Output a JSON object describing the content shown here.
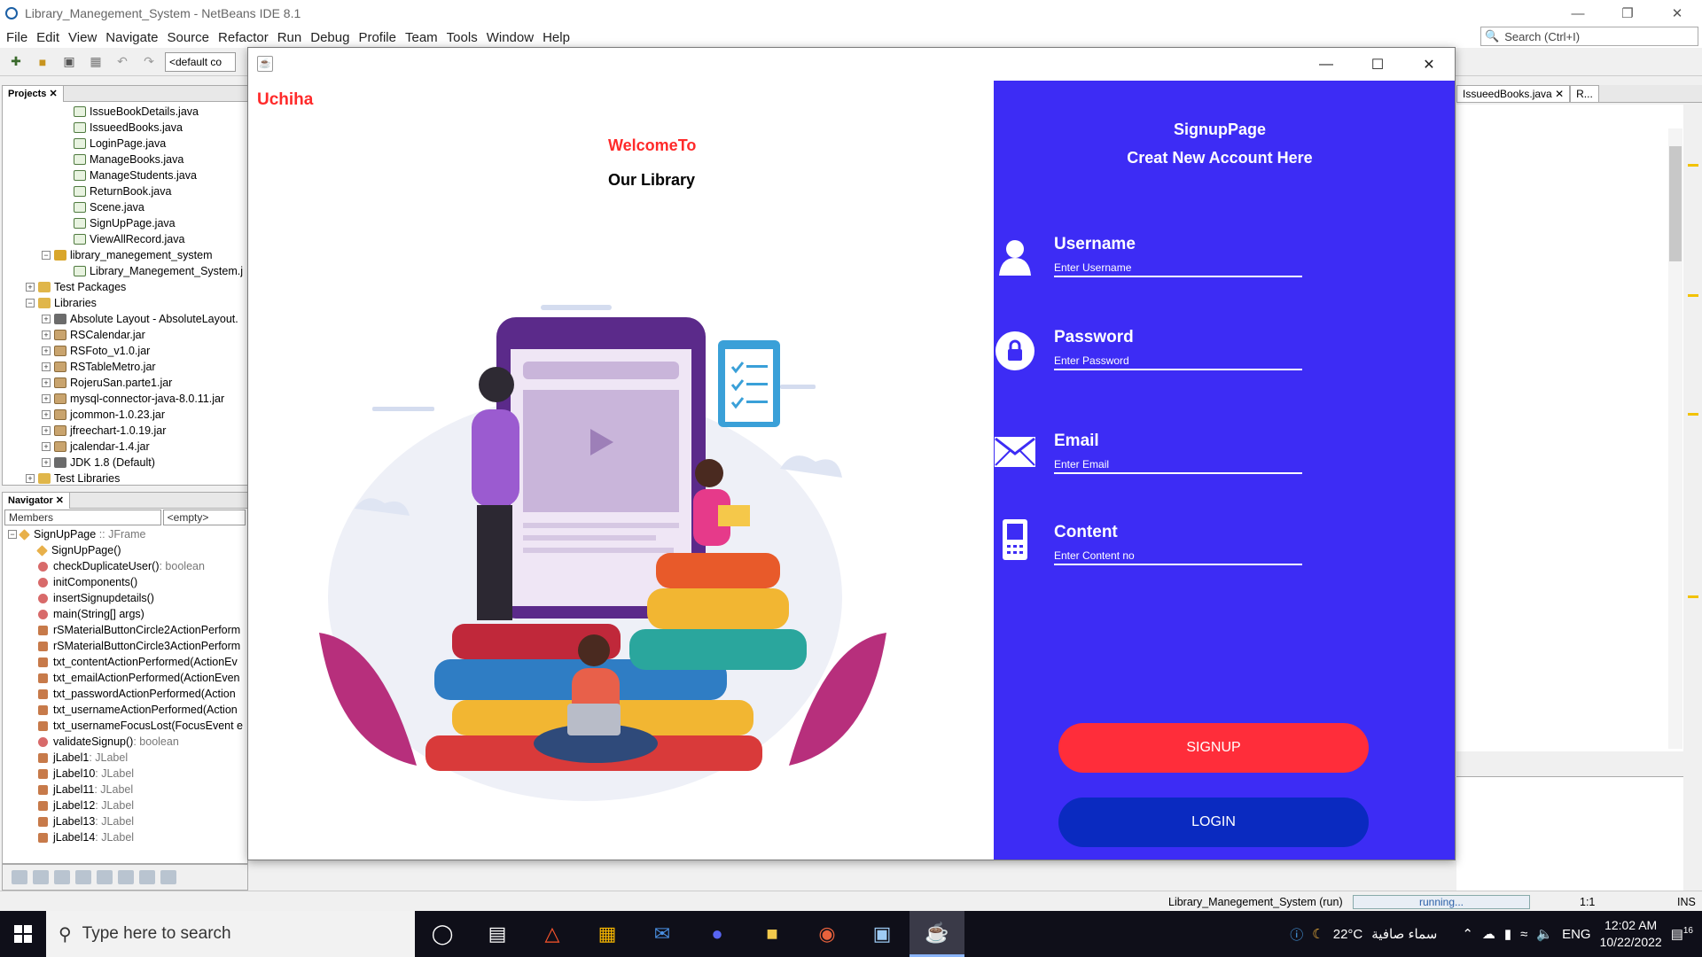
{
  "ide": {
    "title": "Library_Manegement_System - NetBeans IDE 8.1",
    "menu": [
      "File",
      "Edit",
      "View",
      "Navigate",
      "Source",
      "Refactor",
      "Run",
      "Debug",
      "Profile",
      "Team",
      "Tools",
      "Window",
      "Help"
    ],
    "search_placeholder": "Search (Ctrl+I)",
    "config": "<default co",
    "projects_tab": "Projects",
    "navigator_tab": "Navigator",
    "editor_tab": "IssueedBooks.java",
    "editor_tab2": "R...",
    "files": [
      "IssueBookDetails.java",
      "IssueedBooks.java",
      "LoginPage.java",
      "ManageBooks.java",
      "ManageStudents.java",
      "ReturnBook.java",
      "Scene.java",
      "SignUpPage.java",
      "ViewAllRecord.java"
    ],
    "package": "library_manegement_system",
    "package_file": "Library_Manegement_System.j",
    "test_packages": "Test Packages",
    "libraries": "Libraries",
    "libs": [
      "Absolute Layout - AbsoluteLayout.",
      "RSCalendar.jar",
      "RSFoto_v1.0.jar",
      "RSTableMetro.jar",
      "RojeruSan.parte1.jar",
      "mysql-connector-java-8.0.11.jar",
      "jcommon-1.0.23.jar",
      "jfreechart-1.0.19.jar",
      "jcalendar-1.4.jar",
      "JDK 1.8 (Default)"
    ],
    "test_libraries": "Test Libraries",
    "nav_combo1": "Members",
    "nav_combo2": "<empty>",
    "nav_root": "SignUpPage",
    "nav_root_type": ":: JFrame",
    "members": [
      {
        "name": "SignUpPage()",
        "type": "",
        "kind": "ctor"
      },
      {
        "name": "checkDuplicateUser()",
        "type": " : boolean",
        "kind": "method"
      },
      {
        "name": "initComponents()",
        "type": "",
        "kind": "method"
      },
      {
        "name": "insertSignupdetails()",
        "type": "",
        "kind": "method"
      },
      {
        "name": "main(String[] args)",
        "type": "",
        "kind": "method"
      },
      {
        "name": "rSMaterialButtonCircle2ActionPerform",
        "type": "",
        "kind": "field"
      },
      {
        "name": "rSMaterialButtonCircle3ActionPerform",
        "type": "",
        "kind": "field"
      },
      {
        "name": "txt_contentActionPerformed(ActionEv",
        "type": "",
        "kind": "field"
      },
      {
        "name": "txt_emailActionPerformed(ActionEven",
        "type": "",
        "kind": "field"
      },
      {
        "name": "txt_passwordActionPerformed(Action",
        "type": "",
        "kind": "field"
      },
      {
        "name": "txt_usernameActionPerformed(Action",
        "type": "",
        "kind": "field"
      },
      {
        "name": "txt_usernameFocusLost(FocusEvent e",
        "type": "",
        "kind": "field"
      },
      {
        "name": "validateSignup()",
        "type": " : boolean",
        "kind": "method"
      },
      {
        "name": "jLabel1",
        "type": " : JLabel",
        "kind": "field"
      },
      {
        "name": "jLabel10",
        "type": " : JLabel",
        "kind": "field"
      },
      {
        "name": "jLabel11",
        "type": " : JLabel",
        "kind": "field"
      },
      {
        "name": "jLabel12",
        "type": " : JLabel",
        "kind": "field"
      },
      {
        "name": "jLabel13",
        "type": " : JLabel",
        "kind": "field"
      },
      {
        "name": "jLabel14",
        "type": " : JLabel",
        "kind": "field"
      }
    ],
    "status_run": "Library_Manegement_System (run)",
    "status_progress": "running...",
    "status_pos": "1:1",
    "status_ins": "INS"
  },
  "app": {
    "brand": "Uchiha",
    "welcome": "WelcomeTo",
    "our_library": "Our Library",
    "panel_title": "SignupPage",
    "panel_subtitle": "Creat New Account Here",
    "fields": [
      {
        "label": "Username",
        "placeholder": "Enter Username",
        "icon": "user-icon"
      },
      {
        "label": "Password",
        "placeholder": "Enter Password",
        "icon": "lock-icon"
      },
      {
        "label": "Email",
        "placeholder": "Enter Email",
        "icon": "mail-icon"
      },
      {
        "label": "Content",
        "placeholder": "Enter Content no",
        "icon": "phone-icon"
      }
    ],
    "signup_label": "SIGNUP",
    "login_label": "LOGIN",
    "colors": {
      "accent_red": "#ff2a2a",
      "panel_blue": "#3d2cf5",
      "login_blue": "#0a2ac0"
    }
  },
  "taskbar": {
    "search_placeholder": "Type here to search",
    "weather_temp": "22°C",
    "weather_text": "سماء صافية",
    "language": "ENG",
    "time": "12:02 AM",
    "date": "10/22/2022",
    "notification_count": "16"
  }
}
